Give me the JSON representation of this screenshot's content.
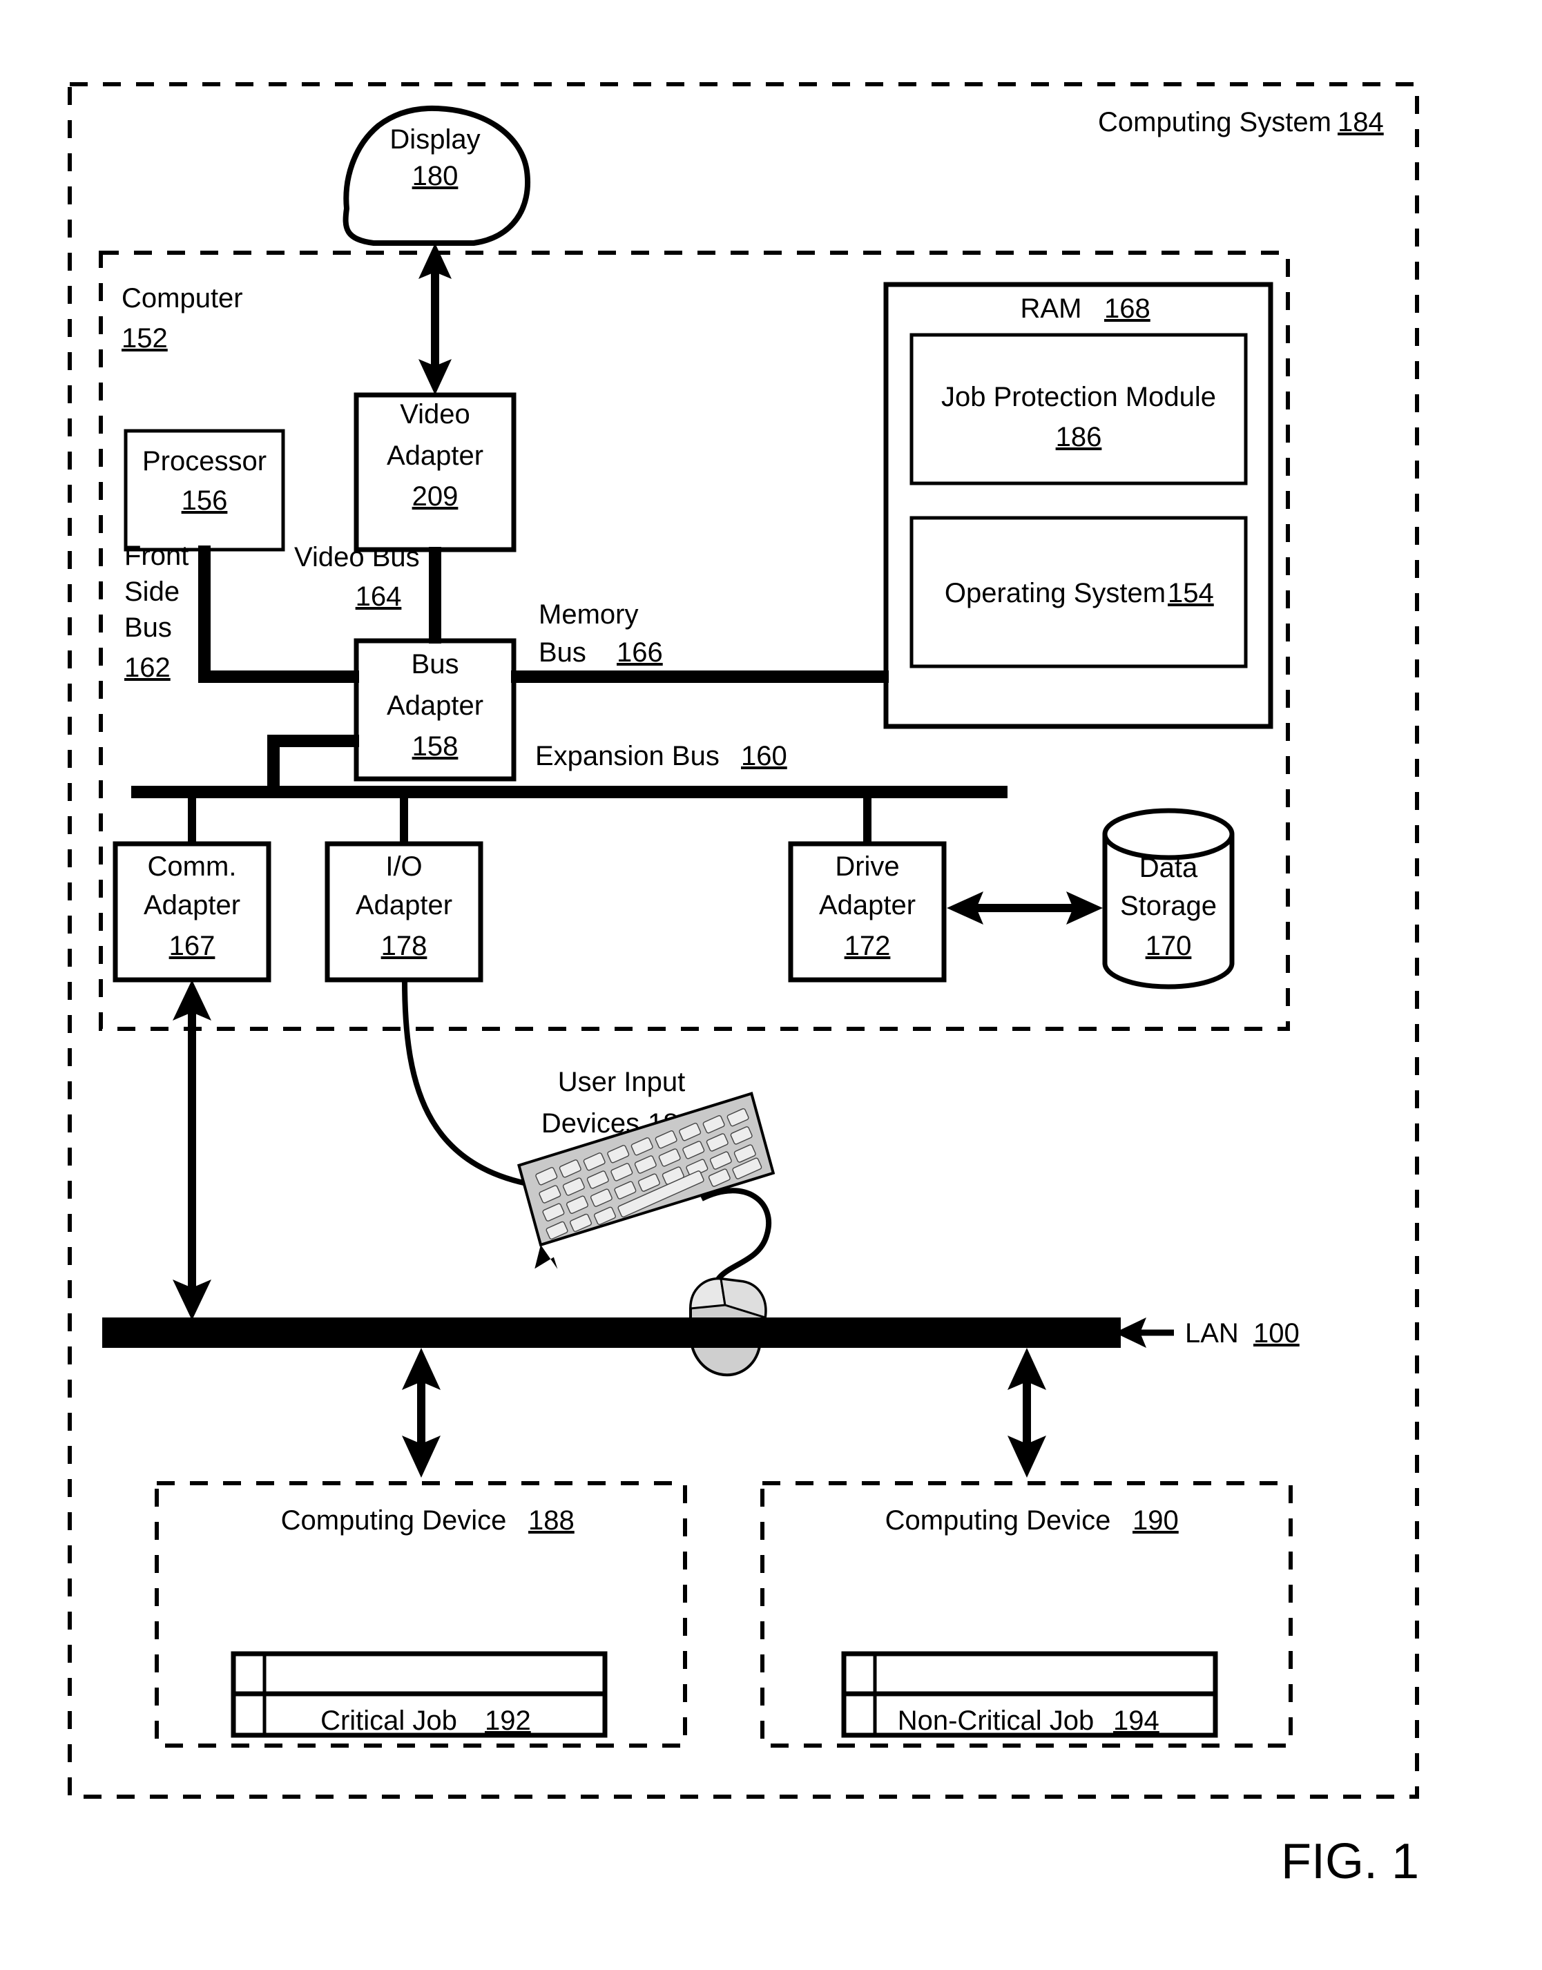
{
  "figure": {
    "caption": "FIG. 1"
  },
  "outer": {
    "label": "Computing System",
    "ref": "184"
  },
  "computer": {
    "label": "Computer",
    "ref": "152"
  },
  "display": {
    "label": "Display",
    "ref": "180"
  },
  "ram": {
    "label": "RAM",
    "ref": "168",
    "modules": [
      {
        "label": "Job Protection Module",
        "ref": "186"
      },
      {
        "label": "Operating System",
        "ref": "154"
      }
    ]
  },
  "processor": {
    "label": "Processor",
    "ref": "156"
  },
  "video_adapter": {
    "line1": "Video",
    "line2": "Adapter",
    "ref": "209"
  },
  "bus_adapter": {
    "line1": "Bus",
    "line2": "Adapter",
    "ref": "158"
  },
  "buses": {
    "front_side": {
      "line1": "Front",
      "line2": "Side",
      "line3": "Bus",
      "ref": "162"
    },
    "video": {
      "label": "Video Bus",
      "ref": "164"
    },
    "memory": {
      "line1": "Memory",
      "line2": "Bus",
      "ref": "166"
    },
    "expansion": {
      "label": "Expansion Bus",
      "ref": "160"
    }
  },
  "adapters": [
    {
      "line1": "Comm.",
      "line2": "Adapter",
      "ref": "167"
    },
    {
      "line1": "I/O",
      "line2": "Adapter",
      "ref": "178"
    },
    {
      "line1": "Drive",
      "line2": "Adapter",
      "ref": "172"
    }
  ],
  "data_storage": {
    "line1": "Data",
    "line2": "Storage",
    "ref": "170"
  },
  "user_input": {
    "line1": "User Input",
    "line2": "Devices",
    "ref": "181"
  },
  "lan": {
    "label": "LAN",
    "ref": "100"
  },
  "devices": [
    {
      "label": "Computing Device",
      "ref": "188",
      "job": {
        "label": "Critical Job",
        "ref": "192"
      }
    },
    {
      "label": "Computing Device",
      "ref": "190",
      "job": {
        "label": "Non-Critical Job",
        "ref": "194"
      }
    }
  ],
  "colors": {
    "ink": "#000000",
    "paper": "#ffffff",
    "keyboard": "#c9c9c9"
  }
}
